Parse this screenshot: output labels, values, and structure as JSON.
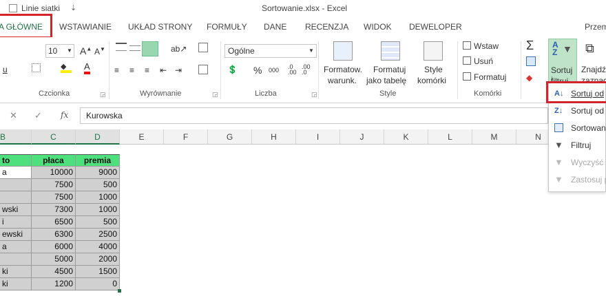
{
  "title_bar": {
    "gridlines_label": "Linie siatki",
    "doc_title": "Sortowanie.xlsx - Excel",
    "qat_chevron": "⇣"
  },
  "tabs": [
    {
      "label": "A GŁÓWNE",
      "active": true
    },
    {
      "label": "WSTAWIANIE"
    },
    {
      "label": "UKŁAD STRONY"
    },
    {
      "label": "FORMUŁY"
    },
    {
      "label": "DANE"
    },
    {
      "label": "RECENZJA"
    },
    {
      "label": "WIDOK"
    },
    {
      "label": "DEWELOPER"
    },
    {
      "label": "Przem"
    }
  ],
  "ribbon": {
    "font_size": "10",
    "number_format": "Ogólne",
    "groups": {
      "font": "Czcionka",
      "alignment": "Wyrównanie",
      "number": "Liczba",
      "styles": "Style",
      "cells": "Komórki"
    },
    "styles": {
      "conditional_line1": "Formatow.",
      "conditional_line2": "warunk.",
      "table_line1": "Formatuj",
      "table_line2": "jako tabelę",
      "cell_styles_line1": "Style",
      "cell_styles_line2": "komórki"
    },
    "cells": {
      "insert": "Wstaw",
      "delete": "Usuń",
      "format": "Formatuj"
    },
    "editing": {
      "sort_line1": "Sortuj i",
      "sort_line2": "filtruj",
      "find_line1": "Znajdź",
      "find_line2": "zaznacz"
    },
    "percent": "%",
    "thousands": "000"
  },
  "formula_bar": {
    "fx": "fx",
    "value": "Kurowska"
  },
  "columns": [
    "B",
    "C",
    "D",
    "E",
    "F",
    "G",
    "H",
    "I",
    "J",
    "K",
    "L",
    "M",
    "N"
  ],
  "table": {
    "headers": [
      "to",
      "płaca",
      "premia"
    ],
    "rows": [
      {
        "name": "a",
        "placa": "10000",
        "premia": "9000"
      },
      {
        "name": "",
        "placa": "7500",
        "premia": "500"
      },
      {
        "name": "",
        "placa": "7500",
        "premia": "1000"
      },
      {
        "name": "wski",
        "placa": "7300",
        "premia": "1000"
      },
      {
        "name": "i",
        "placa": "6500",
        "premia": "500"
      },
      {
        "name": "ewski",
        "placa": "6300",
        "premia": "2500"
      },
      {
        "name": "a",
        "placa": "6000",
        "premia": "4000"
      },
      {
        "name": "",
        "placa": "5000",
        "premia": "2000"
      },
      {
        "name": "ki",
        "placa": "4500",
        "premia": "1500"
      },
      {
        "name": "ki",
        "placa": "1200",
        "premia": "0"
      }
    ]
  },
  "sort_menu": [
    {
      "label": "Sortuj od",
      "icon": "sort-az-icon",
      "enabled": true
    },
    {
      "label": "Sortuj od",
      "icon": "sort-za-icon",
      "enabled": true
    },
    {
      "label": "Sortowani",
      "icon": "custom-sort-icon",
      "enabled": true
    },
    {
      "label": "Filtruj",
      "icon": "filter-icon",
      "enabled": true
    },
    {
      "label": "Wyczyść",
      "icon": "clear-filter-icon",
      "enabled": false
    },
    {
      "label": "Zastosuj p",
      "icon": "reapply-icon",
      "enabled": false
    }
  ],
  "colors": {
    "accent": "#217346",
    "header_fill": "#4ee07c",
    "highlight": "#d4232a",
    "cell_gray": "#d0d0d0"
  }
}
